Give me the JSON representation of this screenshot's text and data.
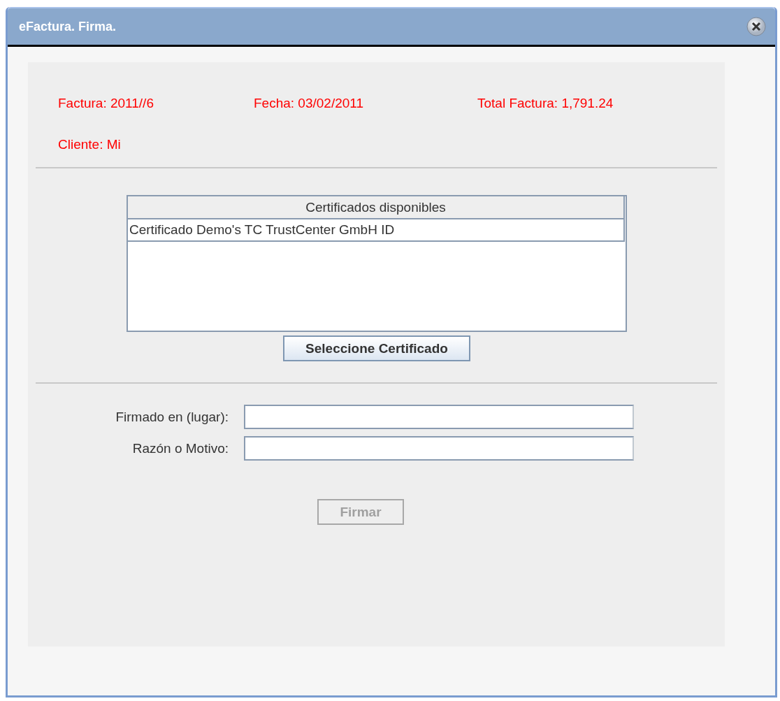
{
  "window": {
    "title": "eFactura. Firma."
  },
  "invoice": [
    {
      "label": "Factura: 2011//6"
    },
    {
      "label": "Fecha: 03/02/2011"
    },
    {
      "label": "Total Factura: 1,791.24"
    },
    {
      "label": "Cliente: Mi"
    }
  ],
  "table": {
    "columns": [
      "Certificados disponibles"
    ],
    "rows": [
      {
        "cells": [
          "Certificado Demo's TC TrustCenter GmbH ID"
        ],
        "selected": false
      }
    ]
  },
  "select_button": {
    "label": "Seleccione Certificado",
    "disabled": false
  },
  "fields": [
    {
      "label": "Firmado en (lugar):"
    },
    {
      "label": "Razón o Motivo:"
    }
  ],
  "sign_button": {
    "label": "Firmar",
    "disabled": true
  }
}
